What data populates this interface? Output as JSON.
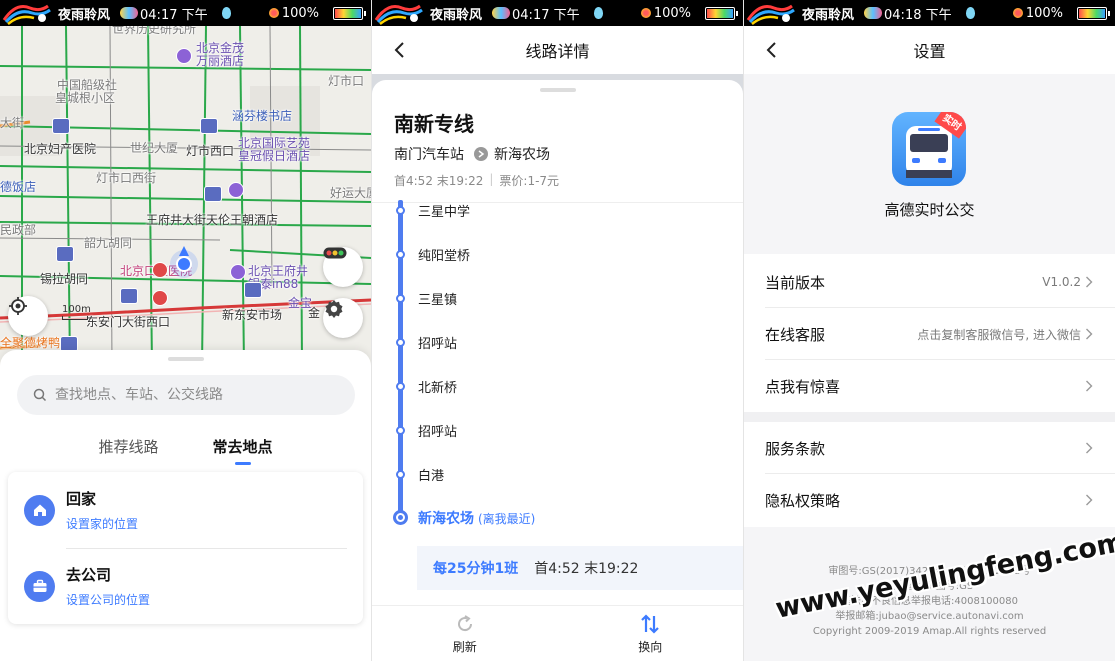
{
  "status_bar": {
    "app_name": "夜雨聆风",
    "times": [
      "04:17 下午",
      "04:17 下午",
      "04:18 下午"
    ],
    "battery": "100%"
  },
  "map_screen": {
    "map_labels": [
      "世界历史研究所",
      "北京金茂万丽酒店",
      "中国船级社",
      "皇城根小区",
      "灯市口",
      "涵芬楼书店",
      "北京妇产医院",
      "灯市西口",
      "北京国际艺苑皇冠假日酒店",
      "德饭店",
      "世纪大厦",
      "好运大厦",
      "灯市口西街",
      "王府井大街天伦王朝酒店",
      "民政部",
      "韶九胡同",
      "锡拉胡同",
      "北京口腔医院",
      "北京王府井",
      "银泰in88",
      "东安门大街西口",
      "新东安市场",
      "金宝",
      "大街",
      "全聚德烤鸭店",
      "金"
    ],
    "scale_label": "100m",
    "search_placeholder": "查找地点、车站、公交线路",
    "tabs": [
      "推荐线路",
      "常去地点"
    ],
    "active_tab": "常去地点",
    "places": [
      {
        "title": "回家",
        "subtitle": "设置家的位置",
        "icon": "home-icon"
      },
      {
        "title": "去公司",
        "subtitle": "设置公司的位置",
        "icon": "briefcase-icon"
      }
    ]
  },
  "route_screen": {
    "nav_title": "线路详情",
    "route_name": "南新专线",
    "origin": "南门汽车站",
    "destination": "新海农场",
    "first_last": "首4:52 末19:22",
    "fare": "票价:1-7元",
    "stops": [
      "三星中学",
      "纯阳堂桥",
      "三星镇",
      "招呼站",
      "北新桥",
      "招呼站",
      "白港"
    ],
    "final_stop": {
      "name": "新海农场",
      "note": "(离我最近)"
    },
    "frequency": "每25分钟1班",
    "frequency_time": "首4:52 末19:22",
    "bottom_actions": {
      "refresh": "刷新",
      "reverse": "换向"
    },
    "accent_color": "#4f7cf0"
  },
  "settings_screen": {
    "nav_title": "设置",
    "app_name": "高德实时公交",
    "app_badge": "实时",
    "rows": [
      {
        "label": "当前版本",
        "value": "V1.0.2"
      },
      {
        "label": "在线客服",
        "value": "点击复制客服微信号, 进入微信"
      },
      {
        "label": "点我有惊喜",
        "value": ""
      },
      {
        "label": "服务条款",
        "value": ""
      },
      {
        "label": "隐私权策略",
        "value": ""
      }
    ],
    "footer_lines": [
      "审图号:GS(2017)3426号 GS(2017)2553号",
      "卫星图片审图号:GS",
      "违法和不良信息举报电话:4008100080",
      "举报邮箱:jubao@service.autonavi.com",
      "Copyright 2009-2019 Amap.All rights reserved"
    ]
  },
  "watermark": "www.yeyulingfeng.com"
}
